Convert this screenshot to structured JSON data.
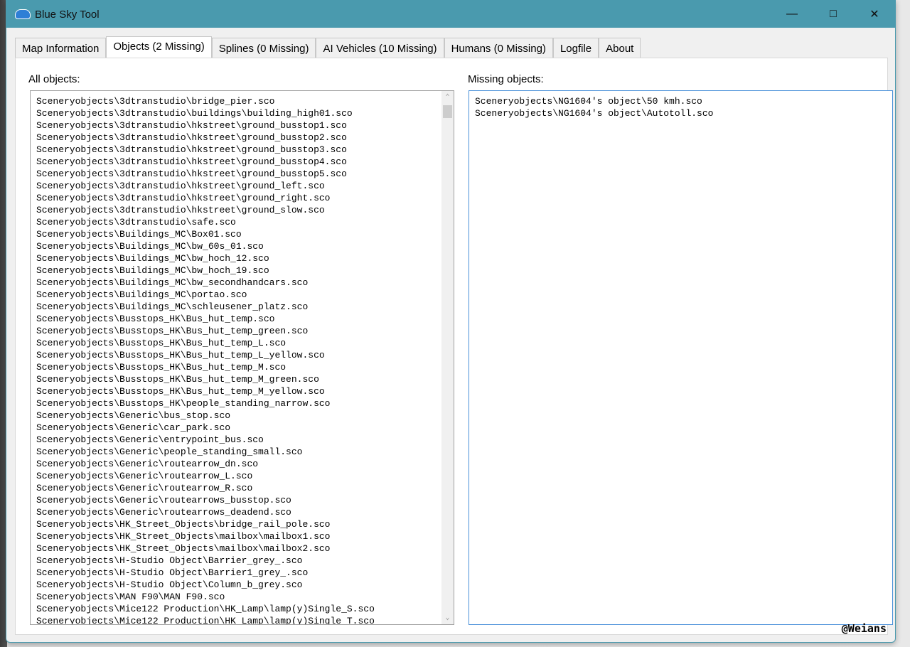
{
  "window": {
    "title": "Blue Sky Tool",
    "controls": [
      "minimize",
      "maximize",
      "close"
    ]
  },
  "tabs": [
    {
      "label": "Map Information"
    },
    {
      "label": "Objects (2 Missing)",
      "active": true
    },
    {
      "label": "Splines (0 Missing)"
    },
    {
      "label": "AI Vehicles (10 Missing)"
    },
    {
      "label": "Humans (0 Missing)"
    },
    {
      "label": "Logfile"
    },
    {
      "label": "About"
    }
  ],
  "all_objects": {
    "label": "All objects:",
    "items": [
      "Sceneryobjects\\3dtranstudio\\bridge_pier.sco",
      "Sceneryobjects\\3dtranstudio\\buildings\\building_high01.sco",
      "Sceneryobjects\\3dtranstudio\\hkstreet\\ground_busstop1.sco",
      "Sceneryobjects\\3dtranstudio\\hkstreet\\ground_busstop2.sco",
      "Sceneryobjects\\3dtranstudio\\hkstreet\\ground_busstop3.sco",
      "Sceneryobjects\\3dtranstudio\\hkstreet\\ground_busstop4.sco",
      "Sceneryobjects\\3dtranstudio\\hkstreet\\ground_busstop5.sco",
      "Sceneryobjects\\3dtranstudio\\hkstreet\\ground_left.sco",
      "Sceneryobjects\\3dtranstudio\\hkstreet\\ground_right.sco",
      "Sceneryobjects\\3dtranstudio\\hkstreet\\ground_slow.sco",
      "Sceneryobjects\\3dtranstudio\\safe.sco",
      "Sceneryobjects\\Buildings_MC\\Box01.sco",
      "Sceneryobjects\\Buildings_MC\\bw_60s_01.sco",
      "Sceneryobjects\\Buildings_MC\\bw_hoch_12.sco",
      "Sceneryobjects\\Buildings_MC\\bw_hoch_19.sco",
      "Sceneryobjects\\Buildings_MC\\bw_secondhandcars.sco",
      "Sceneryobjects\\Buildings_MC\\portao.sco",
      "Sceneryobjects\\Buildings_MC\\schleusener_platz.sco",
      "Sceneryobjects\\Busstops_HK\\Bus_hut_temp.sco",
      "Sceneryobjects\\Busstops_HK\\Bus_hut_temp_green.sco",
      "Sceneryobjects\\Busstops_HK\\Bus_hut_temp_L.sco",
      "Sceneryobjects\\Busstops_HK\\Bus_hut_temp_L_yellow.sco",
      "Sceneryobjects\\Busstops_HK\\Bus_hut_temp_M.sco",
      "Sceneryobjects\\Busstops_HK\\Bus_hut_temp_M_green.sco",
      "Sceneryobjects\\Busstops_HK\\Bus_hut_temp_M_yellow.sco",
      "Sceneryobjects\\Busstops_HK\\people_standing_narrow.sco",
      "Sceneryobjects\\Generic\\bus_stop.sco",
      "Sceneryobjects\\Generic\\car_park.sco",
      "Sceneryobjects\\Generic\\entrypoint_bus.sco",
      "Sceneryobjects\\Generic\\people_standing_small.sco",
      "Sceneryobjects\\Generic\\routearrow_dn.sco",
      "Sceneryobjects\\Generic\\routearrow_L.sco",
      "Sceneryobjects\\Generic\\routearrow_R.sco",
      "Sceneryobjects\\Generic\\routearrows_busstop.sco",
      "Sceneryobjects\\Generic\\routearrows_deadend.sco",
      "Sceneryobjects\\HK_Street_Objects\\bridge_rail_pole.sco",
      "Sceneryobjects\\HK_Street_Objects\\mailbox\\mailbox1.sco",
      "Sceneryobjects\\HK_Street_Objects\\mailbox\\mailbox2.sco",
      "Sceneryobjects\\H-Studio Object\\Barrier_grey_.sco",
      "Sceneryobjects\\H-Studio Object\\Barrier1_grey_.sco",
      "Sceneryobjects\\H-Studio Object\\Column_b_grey.sco",
      "Sceneryobjects\\MAN F90\\MAN F90.sco",
      "Sceneryobjects\\Mice122 Production\\HK_Lamp\\lamp(y)Single_S.sco",
      "Sceneryobjects\\Mice122 Production\\HK_Lamp\\lamp(y)Single_T.sco"
    ]
  },
  "missing_objects": {
    "label": "Missing objects:",
    "items": [
      "Sceneryobjects\\NG1604's object\\50 kmh.sco",
      "Sceneryobjects\\NG1604's object\\Autotoll.sco"
    ]
  },
  "watermark": "@Weians"
}
